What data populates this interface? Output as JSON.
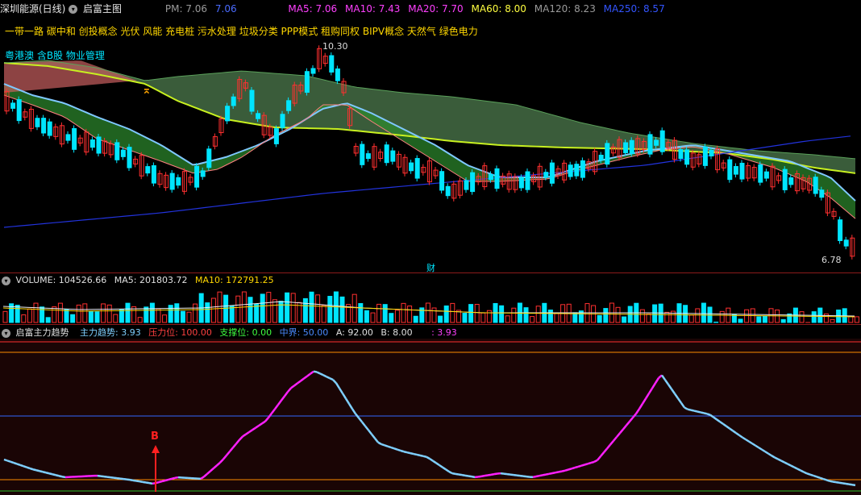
{
  "main": {
    "title": "深圳能源(日线)",
    "indicator": "启富主图",
    "pm_label": "PM: 7.06",
    "pm_value": "7.06",
    "ma5": "MA5: 7.06",
    "ma10": "MA10: 7.43",
    "ma20": "MA20: 7.70",
    "ma60": "MA60: 8.00",
    "ma120": "MA120: 8.23",
    "ma250": "MA250: 8.57",
    "concepts": "一带一路 碳中和 创投概念 光伏 风能 充电桩 污水处理 垃圾分类 PPP模式 租购同权 BIPV概念 天然气 绿色电力",
    "concepts2": "粤港澳 含B股 物业管理",
    "high_label": "10.30",
    "low_label": "6.78",
    "finance_marker": "财",
    "signal_marker": "⌅"
  },
  "volume": {
    "label": "VOLUME: 104526.66",
    "ma5": "MA5: 201803.72",
    "ma10": "MA10: 172791.25"
  },
  "trend": {
    "title": "启富主力趋势",
    "main": "主力趋势: 3.93",
    "pressure": "压力位: 100.00",
    "support": "支撑位: 0.00",
    "mid": "中界: 50.00",
    "a": "A: 92.00",
    "b": "B: 8.00",
    "extra": ": 3.93",
    "buy_marker": "B"
  },
  "colors": {
    "up": "#ff3030",
    "down": "#00e5ff",
    "ma5": "#ffffff",
    "ma10": "#ffd700",
    "ma20": "#ff00ff",
    "ma60": "#00ff00",
    "ma120": "#aaaaaa",
    "ma250": "#3344ff"
  }
}
